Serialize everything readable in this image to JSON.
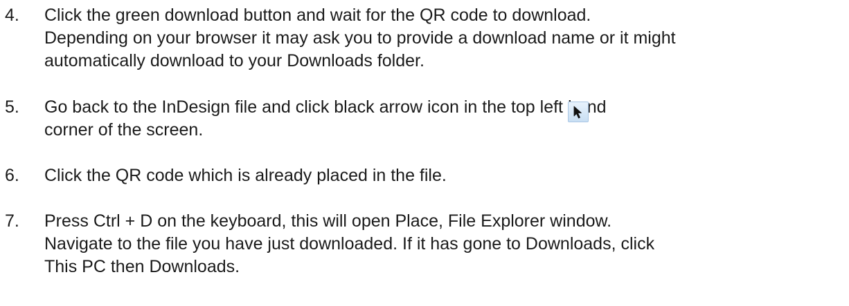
{
  "steps": [
    {
      "number": "4.",
      "lines": [
        "Click the green download button and wait for the QR code to download.",
        "Depending on your browser it may ask you to provide a download name or it might",
        "automatically download to your Downloads folder."
      ]
    },
    {
      "number": "5.",
      "lines": [
        "Go back to the InDesign file and click black arrow icon in the top left hand",
        "corner of the screen."
      ],
      "icon": "selection-tool-arrow-icon"
    },
    {
      "number": "6.",
      "lines": [
        "Click the QR code which is already placed in the file."
      ]
    },
    {
      "number": "7.",
      "lines": [
        "Press Ctrl + D on the keyboard, this will open Place, File Explorer window.",
        "Navigate to the file you have just downloaded. If it has gone to Downloads, click",
        "This PC then Downloads."
      ]
    }
  ]
}
